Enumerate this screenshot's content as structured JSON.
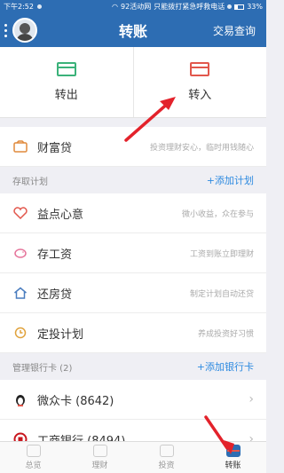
{
  "status": {
    "time": "下午2:52",
    "carrier": "92活动网",
    "notice": "只能拨打紧急呼救电话",
    "battery": "33%"
  },
  "header": {
    "title": "转账",
    "history": "交易查询"
  },
  "transfer": {
    "out_label": "转出",
    "in_label": "转入"
  },
  "wealth": {
    "name": "财富贷",
    "desc": "投资理财安心，临时用钱随心"
  },
  "plans": {
    "section_title": "存取计划",
    "add": "+添加计划",
    "items": [
      {
        "name": "益点心意",
        "desc": "微小收益，众在参与"
      },
      {
        "name": "存工资",
        "desc": "工资到账立即理财"
      },
      {
        "name": "还房贷",
        "desc": "制定计划自动还贷"
      },
      {
        "name": "定投计划",
        "desc": "养成投资好习惯"
      }
    ]
  },
  "cards": {
    "section_title": "管理银行卡 (2)",
    "add": "+添加银行卡",
    "items": [
      {
        "name": "微众卡 (8642)"
      },
      {
        "name": "工商银行 (8494)"
      }
    ]
  },
  "tabs": [
    {
      "label": "总览"
    },
    {
      "label": "理财"
    },
    {
      "label": "投资"
    },
    {
      "label": "转账"
    }
  ]
}
